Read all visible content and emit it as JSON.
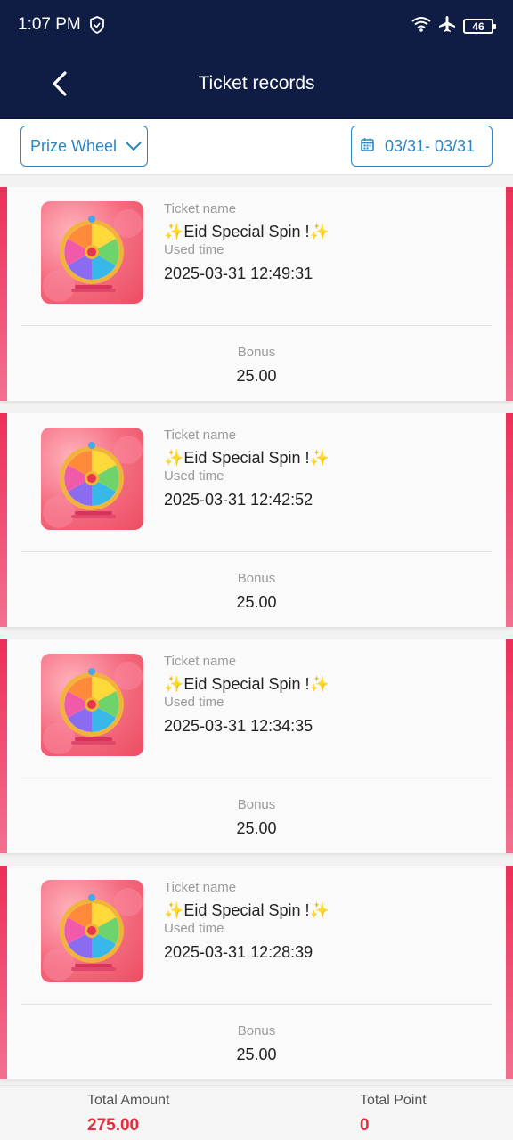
{
  "status_bar": {
    "time": "1:07 PM",
    "battery": "46"
  },
  "header": {
    "title": "Ticket records"
  },
  "filters": {
    "category": "Prize Wheel",
    "date_range": "03/31- 03/31"
  },
  "labels": {
    "ticket_name": "Ticket name",
    "used_time": "Used time",
    "bonus": "Bonus"
  },
  "records": [
    {
      "ticket_name": "✨Eid Special Spin !✨",
      "used_time": "2025-03-31 12:49:31",
      "bonus": "25.00"
    },
    {
      "ticket_name": "✨Eid Special Spin !✨",
      "used_time": "2025-03-31 12:42:52",
      "bonus": "25.00"
    },
    {
      "ticket_name": "✨Eid Special Spin !✨",
      "used_time": "2025-03-31 12:34:35",
      "bonus": "25.00"
    },
    {
      "ticket_name": "✨Eid Special Spin !✨",
      "used_time": "2025-03-31 12:28:39",
      "bonus": "25.00"
    }
  ],
  "footer": {
    "total_amount_label": "Total Amount",
    "total_amount": "275.00",
    "total_point_label": "Total Point",
    "total_point": "0"
  },
  "colors": {
    "header_bg": "#0f1d45",
    "accent": "#2a86c4",
    "card_edge": "#ee2e58",
    "total_value": "#e0303f"
  },
  "icons": [
    "shield-icon",
    "wifi-icon",
    "airplane-icon",
    "battery-icon",
    "back-arrow-icon",
    "chevron-down-icon",
    "calendar-icon",
    "prize-wheel-icon"
  ]
}
